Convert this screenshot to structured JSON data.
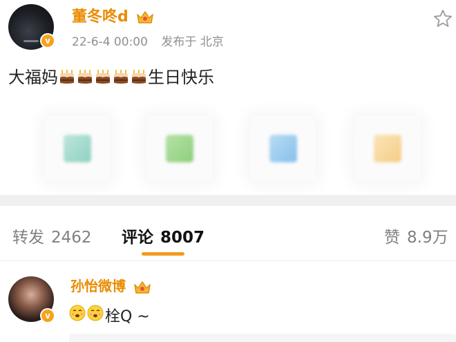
{
  "post": {
    "username": "董冬咚d",
    "time": "22-6-4 00:00",
    "location": "发布于 北京",
    "text_before": "大福妈",
    "text_after": "生日快乐",
    "cake_count": 5,
    "icons": {
      "verified": "v-badge-icon",
      "crown": "crown-icon",
      "favorite": "star-icon",
      "cake": "birthday-cake-icon"
    },
    "thumbnails": [
      {
        "color": "#8fd1c0"
      },
      {
        "color": "#8dcf7c"
      },
      {
        "color": "#86c0ec"
      },
      {
        "color": "#f5cd86"
      }
    ]
  },
  "tabs": {
    "repost_label": "转发",
    "repost_count": "2462",
    "comment_label": "评论",
    "comment_count": "8007",
    "like_label": "赞",
    "like_count": "8.9万",
    "active": "comment",
    "accent": "#f29b1f"
  },
  "comment": {
    "username": "孙怡微博",
    "text": "栓Q ~",
    "emoji_count": 2
  },
  "colors": {
    "username": "#ea8c00",
    "badge": "#f7a21b",
    "meta": "#8f8f8f"
  }
}
